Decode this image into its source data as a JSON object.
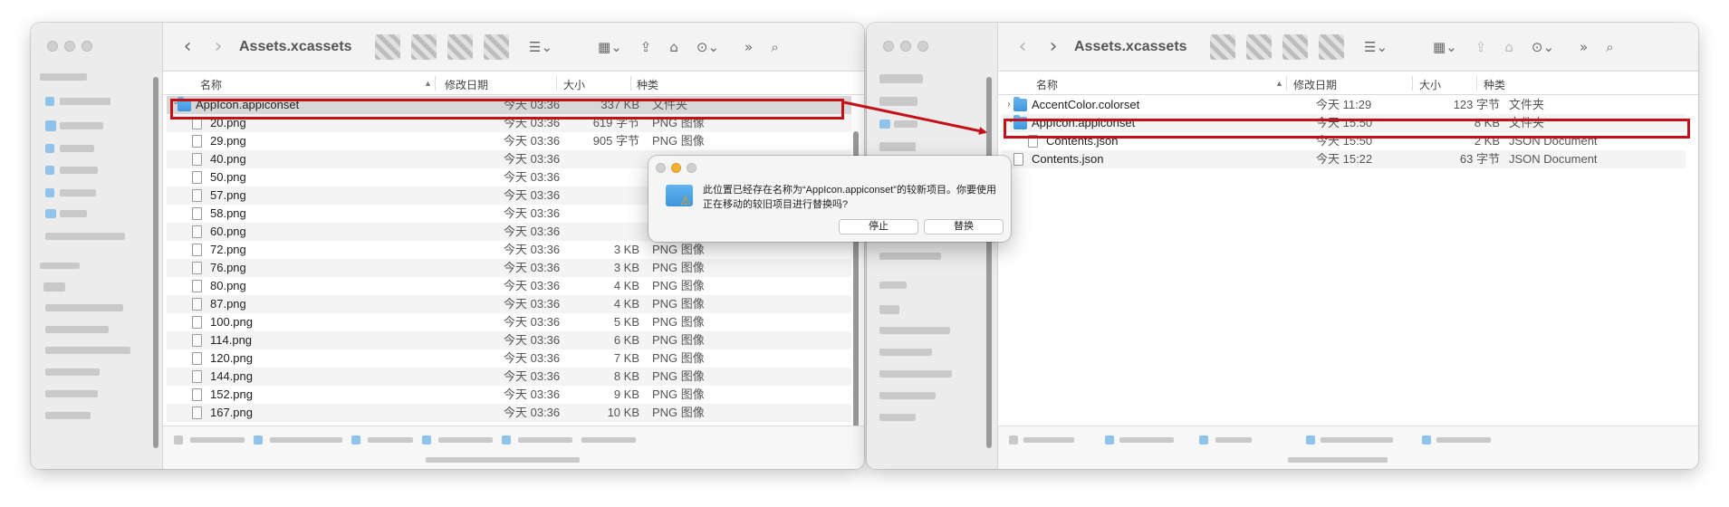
{
  "left_window": {
    "title": "Assets.xcassets",
    "columns": {
      "name": "名称",
      "date": "修改日期",
      "size": "大小",
      "kind": "种类"
    },
    "rows": [
      {
        "name": "AppIcon.appiconset",
        "date": "今天 03:36",
        "size": "337 KB",
        "kind": "文件夹",
        "type": "folder",
        "expanded": true
      },
      {
        "name": "20.png",
        "date": "今天 03:36",
        "size": "619 字节",
        "kind": "PNG 图像",
        "type": "file"
      },
      {
        "name": "29.png",
        "date": "今天 03:36",
        "size": "905 字节",
        "kind": "PNG 图像",
        "type": "file"
      },
      {
        "name": "40.png",
        "date": "今天 03:36",
        "size": "",
        "kind": "",
        "type": "file"
      },
      {
        "name": "50.png",
        "date": "今天 03:36",
        "size": "",
        "kind": "",
        "type": "file"
      },
      {
        "name": "57.png",
        "date": "今天 03:36",
        "size": "",
        "kind": "",
        "type": "file"
      },
      {
        "name": "58.png",
        "date": "今天 03:36",
        "size": "",
        "kind": "",
        "type": "file"
      },
      {
        "name": "60.png",
        "date": "今天 03:36",
        "size": "",
        "kind": "",
        "type": "file"
      },
      {
        "name": "72.png",
        "date": "今天 03:36",
        "size": "3 KB",
        "kind": "PNG 图像",
        "type": "file"
      },
      {
        "name": "76.png",
        "date": "今天 03:36",
        "size": "3 KB",
        "kind": "PNG 图像",
        "type": "file"
      },
      {
        "name": "80.png",
        "date": "今天 03:36",
        "size": "4 KB",
        "kind": "PNG 图像",
        "type": "file"
      },
      {
        "name": "87.png",
        "date": "今天 03:36",
        "size": "4 KB",
        "kind": "PNG 图像",
        "type": "file"
      },
      {
        "name": "100.png",
        "date": "今天 03:36",
        "size": "5 KB",
        "kind": "PNG 图像",
        "type": "file"
      },
      {
        "name": "114.png",
        "date": "今天 03:36",
        "size": "6 KB",
        "kind": "PNG 图像",
        "type": "file"
      },
      {
        "name": "120.png",
        "date": "今天 03:36",
        "size": "7 KB",
        "kind": "PNG 图像",
        "type": "file"
      },
      {
        "name": "144.png",
        "date": "今天 03:36",
        "size": "8 KB",
        "kind": "PNG 图像",
        "type": "file"
      },
      {
        "name": "152.png",
        "date": "今天 03:36",
        "size": "9 KB",
        "kind": "PNG 图像",
        "type": "file"
      },
      {
        "name": "167.png",
        "date": "今天 03:36",
        "size": "10 KB",
        "kind": "PNG 图像",
        "type": "file"
      }
    ]
  },
  "right_window": {
    "title": "Assets.xcassets",
    "columns": {
      "name": "名称",
      "date": "修改日期",
      "size": "大小",
      "kind": "种类"
    },
    "rows": [
      {
        "name": "AccentColor.colorset",
        "date": "今天 11:29",
        "size": "123 字节",
        "kind": "文件夹",
        "type": "folder",
        "expanded": false
      },
      {
        "name": "AppIcon.appiconset",
        "date": "今天 15:50",
        "size": "8 KB",
        "kind": "文件夹",
        "type": "folder",
        "expanded": true
      },
      {
        "name": "Contents.json",
        "date": "今天 15:50",
        "size": "2 KB",
        "kind": "JSON Document",
        "type": "file",
        "indent": true
      },
      {
        "name": "Contents.json",
        "date": "今天 15:22",
        "size": "63 字节",
        "kind": "JSON Document",
        "type": "file"
      }
    ]
  },
  "dialog": {
    "message": "此位置已经存在名称为“AppIcon.appiconset”的较新项目。你要使用正在移动的较旧项目进行替换吗?",
    "stop_label": "停止",
    "replace_label": "替换"
  },
  "colors": {
    "highlight": "#c5101a",
    "folder": "#3c96dd",
    "minimize": "#f4b230"
  }
}
